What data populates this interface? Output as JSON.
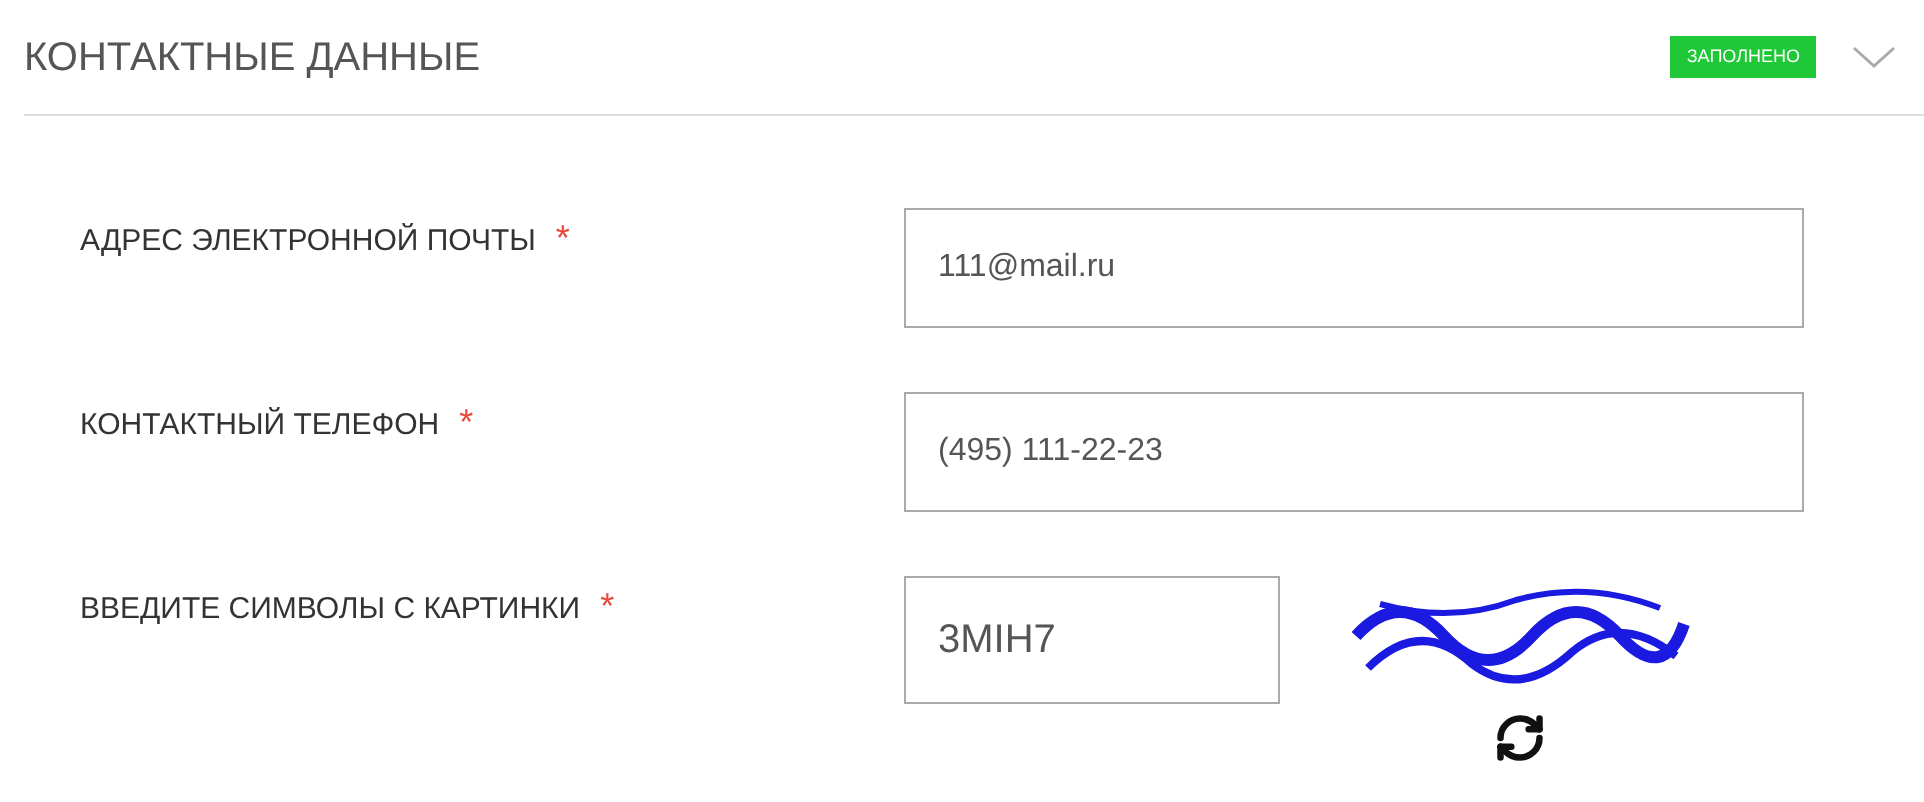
{
  "section": {
    "title": "КОНТАКТНЫЕ ДАННЫЕ",
    "badge": "ЗАПОЛНЕНО",
    "expanded": false
  },
  "fields": [
    {
      "kind": "text",
      "label": "АДРЕС ЭЛЕКТРОННОЙ ПОЧТЫ",
      "required": true,
      "value": "111@mail.ru"
    },
    {
      "kind": "text",
      "label": "КОНТАКТНЫЙ ТЕЛЕФОН",
      "required": true,
      "value": "(495) 111-22-23"
    },
    {
      "kind": "captcha",
      "label": "ВВЕДИТЕ СИМВОЛЫ С КАРТИНКИ",
      "required": true,
      "value": "3MIH7"
    }
  ],
  "required_mark": "*"
}
